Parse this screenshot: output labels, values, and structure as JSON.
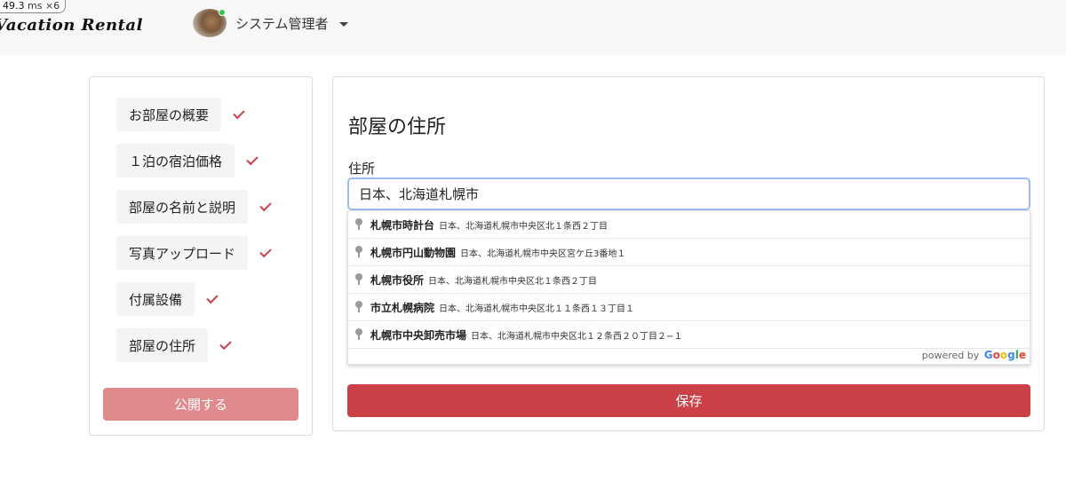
{
  "perf": {
    "value": "49.3",
    "unit": "ms",
    "mult": "×6"
  },
  "header": {
    "brand": "Vacation Rental",
    "username": "システム管理者"
  },
  "steps": [
    {
      "label": "お部屋の概要"
    },
    {
      "label": "１泊の宿泊価格"
    },
    {
      "label": "部屋の名前と説明"
    },
    {
      "label": "写真アップロード"
    },
    {
      "label": "付属設備"
    },
    {
      "label": "部屋の住所"
    }
  ],
  "publish_label": "公開する",
  "form": {
    "title": "部屋の住所",
    "address_label": "住所",
    "address_value": "日本、北海道札幌市",
    "save_label": "保存"
  },
  "suggestions": [
    {
      "main": "札幌市時計台",
      "sub": "日本、北海道札幌市中央区北１条西２丁目"
    },
    {
      "main": "札幌市円山動物園",
      "sub": "日本、北海道札幌市中央区宮ケ丘3番地１"
    },
    {
      "main": "札幌市役所",
      "sub": "日本、北海道札幌市中央区北１条西２丁目"
    },
    {
      "main": "市立札幌病院",
      "sub": "日本、北海道札幌市中央区北１１条西１３丁目１"
    },
    {
      "main": "札幌市中央卸売市場",
      "sub": "日本、北海道札幌市中央区北１２条西２０丁目２−１"
    }
  ],
  "powered_by": "powered by",
  "google": {
    "g": "G",
    "o1": "o",
    "o2": "o",
    "g2": "g",
    "l": "l",
    "e": "e"
  },
  "colors": {
    "accent": "#cc4148",
    "publish_disabled": "#e08a8e",
    "input_focus": "#9bbcf0"
  },
  "icons": {
    "check": "check-icon",
    "pin": "map-pin-icon",
    "caret": "chevron-down-icon"
  }
}
